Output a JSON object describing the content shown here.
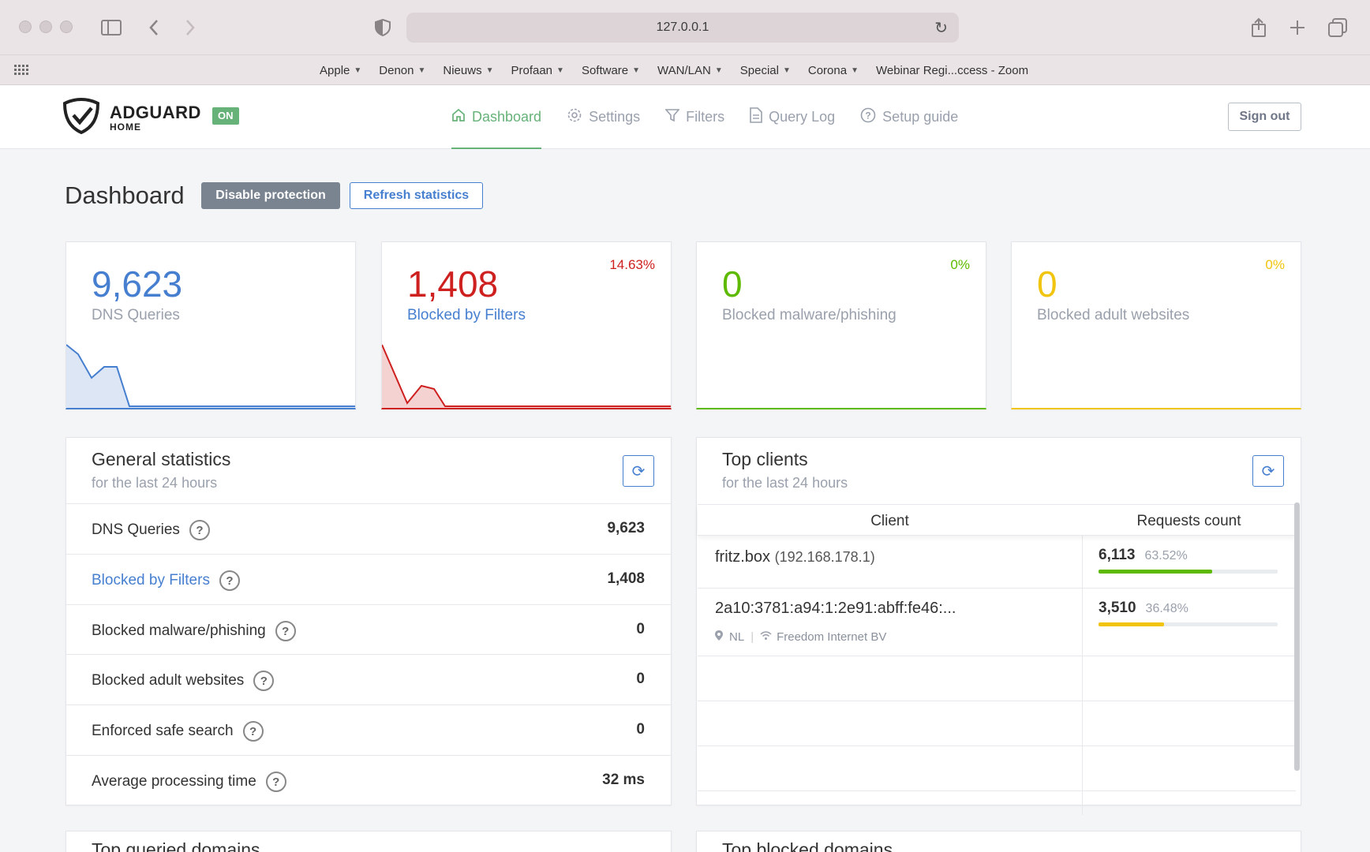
{
  "browser": {
    "url": "127.0.0.1",
    "bookmarks": [
      "Apple",
      "Denon",
      "Nieuws",
      "Profaan",
      "Software",
      "WAN/LAN",
      "Special",
      "Corona"
    ],
    "bookmark_last": "Webinar Regi...ccess - Zoom"
  },
  "header": {
    "logo_title": "ADGUARD",
    "logo_sub": "HOME",
    "status_badge": "ON",
    "nav": {
      "dashboard": "Dashboard",
      "settings": "Settings",
      "filters": "Filters",
      "query_log": "Query Log",
      "setup_guide": "Setup guide"
    },
    "sign_out": "Sign out"
  },
  "dashboard": {
    "title": "Dashboard",
    "disable_protection": "Disable protection",
    "refresh_statistics": "Refresh statistics"
  },
  "stats": {
    "dns": {
      "value": "9,623",
      "label": "DNS Queries",
      "color": "#467fcf"
    },
    "blocked": {
      "value": "1,408",
      "label": "Blocked by Filters",
      "percent": "14.63%",
      "color": "#cd201f"
    },
    "malware": {
      "value": "0",
      "label": "Blocked malware/phishing",
      "percent": "0%",
      "color": "#5eba00"
    },
    "adult": {
      "value": "0",
      "label": "Blocked adult websites",
      "percent": "0%",
      "color": "#f1c40f"
    }
  },
  "general_statistics": {
    "title": "General statistics",
    "subtitle": "for the last 24 hours",
    "rows": [
      {
        "label": "DNS Queries",
        "value": "9,623"
      },
      {
        "label": "Blocked by Filters",
        "value": "1,408"
      },
      {
        "label": "Blocked malware/phishing",
        "value": "0"
      },
      {
        "label": "Blocked adult websites",
        "value": "0"
      },
      {
        "label": "Enforced safe search",
        "value": "0"
      },
      {
        "label": "Average processing time",
        "value": "32 ms"
      }
    ],
    "help_glyph": "?"
  },
  "top_clients": {
    "title": "Top clients",
    "subtitle": "for the last 24 hours",
    "columns": [
      "Client",
      "Requests count"
    ],
    "clients": [
      {
        "name": "fritz.box",
        "ip": "(192.168.178.1)",
        "count": "6,113",
        "percent": "63.52%",
        "share": 63.52,
        "bar_color": "#5eba00"
      },
      {
        "name": "2a10:3781:a94:1:2e91:abff:fe46:...",
        "country": "NL",
        "network": "Freedom Internet BV",
        "count": "3,510",
        "percent": "36.48%",
        "share": 36.48,
        "bar_color": "#f1c40f"
      }
    ]
  },
  "bottom": {
    "left_title": "Top queried domains",
    "right_title": "Top blocked domains"
  }
}
